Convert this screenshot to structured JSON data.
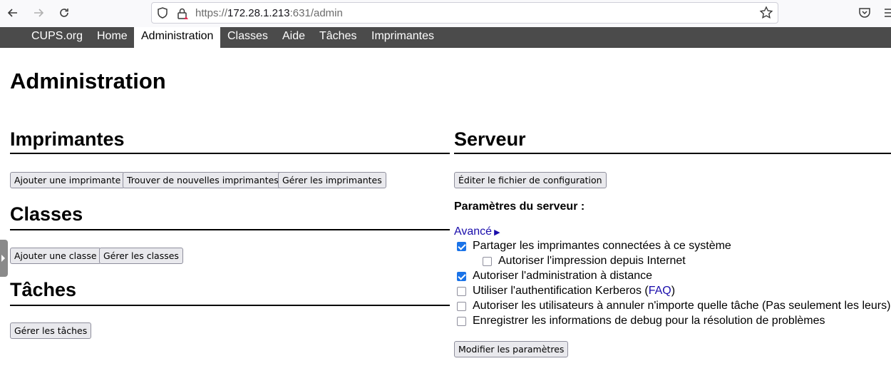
{
  "browser": {
    "url_scheme": "https://",
    "url_host": "172.28.1.213",
    "url_rest": ":631/admin"
  },
  "nav": {
    "items": [
      "CUPS.org",
      "Home",
      "Administration",
      "Classes",
      "Aide",
      "Tâches",
      "Imprimantes"
    ],
    "active": "Administration"
  },
  "page": {
    "title": "Administration"
  },
  "printers": {
    "title": "Imprimantes",
    "buttons": [
      "Ajouter une imprimante",
      "Trouver de nouvelles imprimantes",
      "Gérer les imprimantes"
    ]
  },
  "classes": {
    "title": "Classes",
    "buttons": [
      "Ajouter une classe",
      "Gérer les classes"
    ]
  },
  "jobs": {
    "title": "Tâches",
    "buttons": [
      "Gérer les tâches"
    ]
  },
  "server": {
    "title": "Serveur",
    "edit_config_button": "Éditer le fichier de configuration",
    "settings_label": "Paramètres du serveur :",
    "advanced_link": "Avancé",
    "options": [
      {
        "label": "Partager les imprimantes connectées à ce système",
        "checked": true
      },
      {
        "label": "Autoriser l'impression depuis Internet",
        "checked": false
      },
      {
        "label": "Autoriser l'administration à distance",
        "checked": true
      },
      {
        "label": "Utiliser l'authentification Kerberos (",
        "link": "FAQ",
        "suffix": ")",
        "checked": false
      },
      {
        "label": "Autoriser les utilisateurs à annuler n'importe quelle tâche (Pas seulement les leurs)",
        "checked": false
      },
      {
        "label": "Enregistrer les informations de debug pour la résolution de problèmes",
        "checked": false
      }
    ],
    "modify_button": "Modifier les paramètres"
  },
  "colors": {
    "nav_bg": "#4b4b4b",
    "link": "#1a0dab",
    "checkbox_checked": "#1a73e8"
  }
}
